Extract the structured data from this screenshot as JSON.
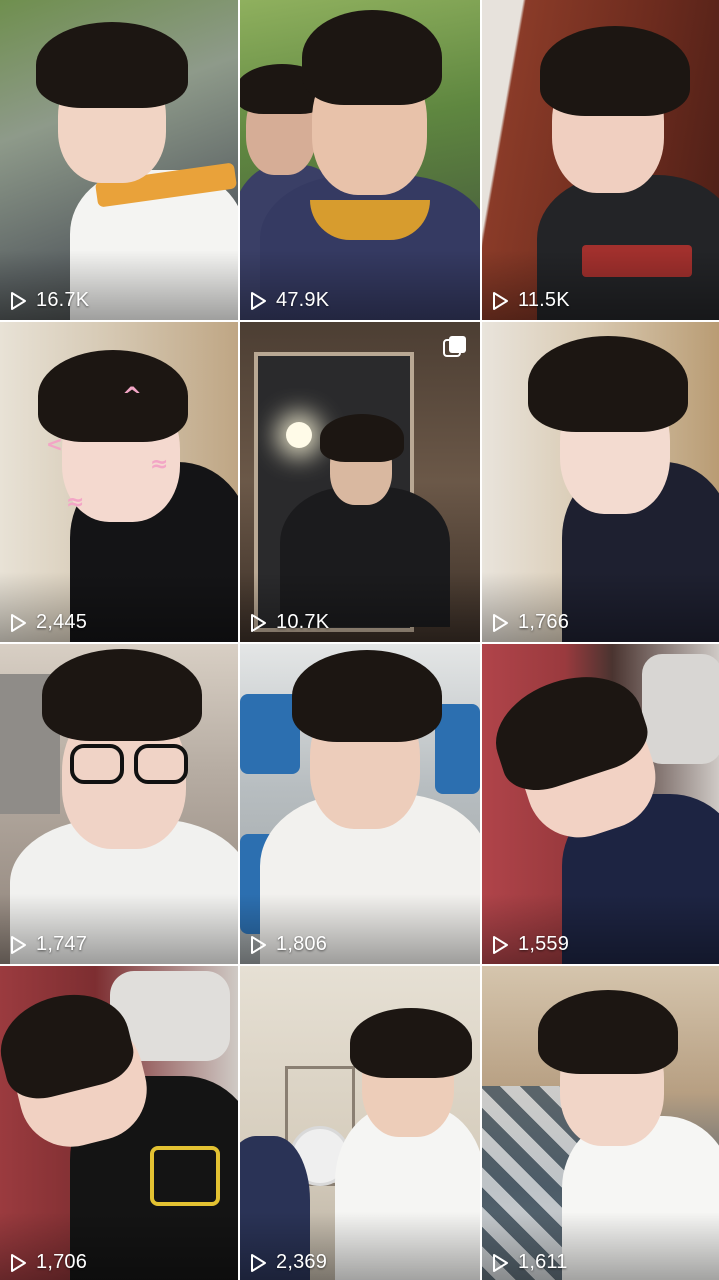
{
  "grid": {
    "tiles": [
      {
        "views": "16.7K",
        "bg": "#7d8a6a",
        "skin": "#f1d4c4",
        "shirt": "#f4f4f2",
        "accent": "#e9a23a",
        "multi": false
      },
      {
        "views": "47.9K",
        "bg": "#6f8b4c",
        "skin": "#e8c2aa",
        "shirt": "#3a3f66",
        "accent": "#d79c2e",
        "multi": false
      },
      {
        "views": "11.5K",
        "bg": "#7a3a2a",
        "skin": "#f0cfc0",
        "shirt": "#232427",
        "accent": "#c2332f",
        "multi": false
      },
      {
        "views": "2,445",
        "bg": "#cdb89c",
        "skin": "#f4d9cf",
        "shirt": "#141416",
        "accent": "#f3a6c6",
        "multi": false
      },
      {
        "views": "10.7K",
        "bg": "#5a4a3c",
        "skin": "#d9b8a0",
        "shirt": "#1b1b1d",
        "accent": "#ffffff",
        "multi": true
      },
      {
        "views": "1,766",
        "bg": "#c2a987",
        "skin": "#f3dbd0",
        "shirt": "#1e2030",
        "accent": "#ffffff",
        "multi": false
      },
      {
        "views": "1,747",
        "bg": "#9b8f86",
        "skin": "#f0d3c6",
        "shirt": "#f1f1ef",
        "accent": "#111111",
        "multi": false
      },
      {
        "views": "1,806",
        "bg": "#b9bfc4",
        "skin": "#edcdbb",
        "shirt": "#f2f1ee",
        "accent": "#2c6fb0",
        "multi": false
      },
      {
        "views": "1,559",
        "bg": "#9a3a3e",
        "skin": "#f2d2c4",
        "shirt": "#1d2442",
        "accent": "#e0e0e0",
        "multi": false
      },
      {
        "views": "1,706",
        "bg": "#9b3b3f",
        "skin": "#f1d1c2",
        "shirt": "#141414",
        "accent": "#e3c232",
        "multi": false
      },
      {
        "views": "2,369",
        "bg": "#d9d0c0",
        "skin": "#edcdb9",
        "shirt": "#f5f5f3",
        "accent": "#2a3356",
        "multi": false
      },
      {
        "views": "1,611",
        "bg": "#b79f82",
        "skin": "#f1d5c7",
        "shirt": "#f6f6f4",
        "accent": "#4a5a66",
        "multi": false
      }
    ]
  }
}
